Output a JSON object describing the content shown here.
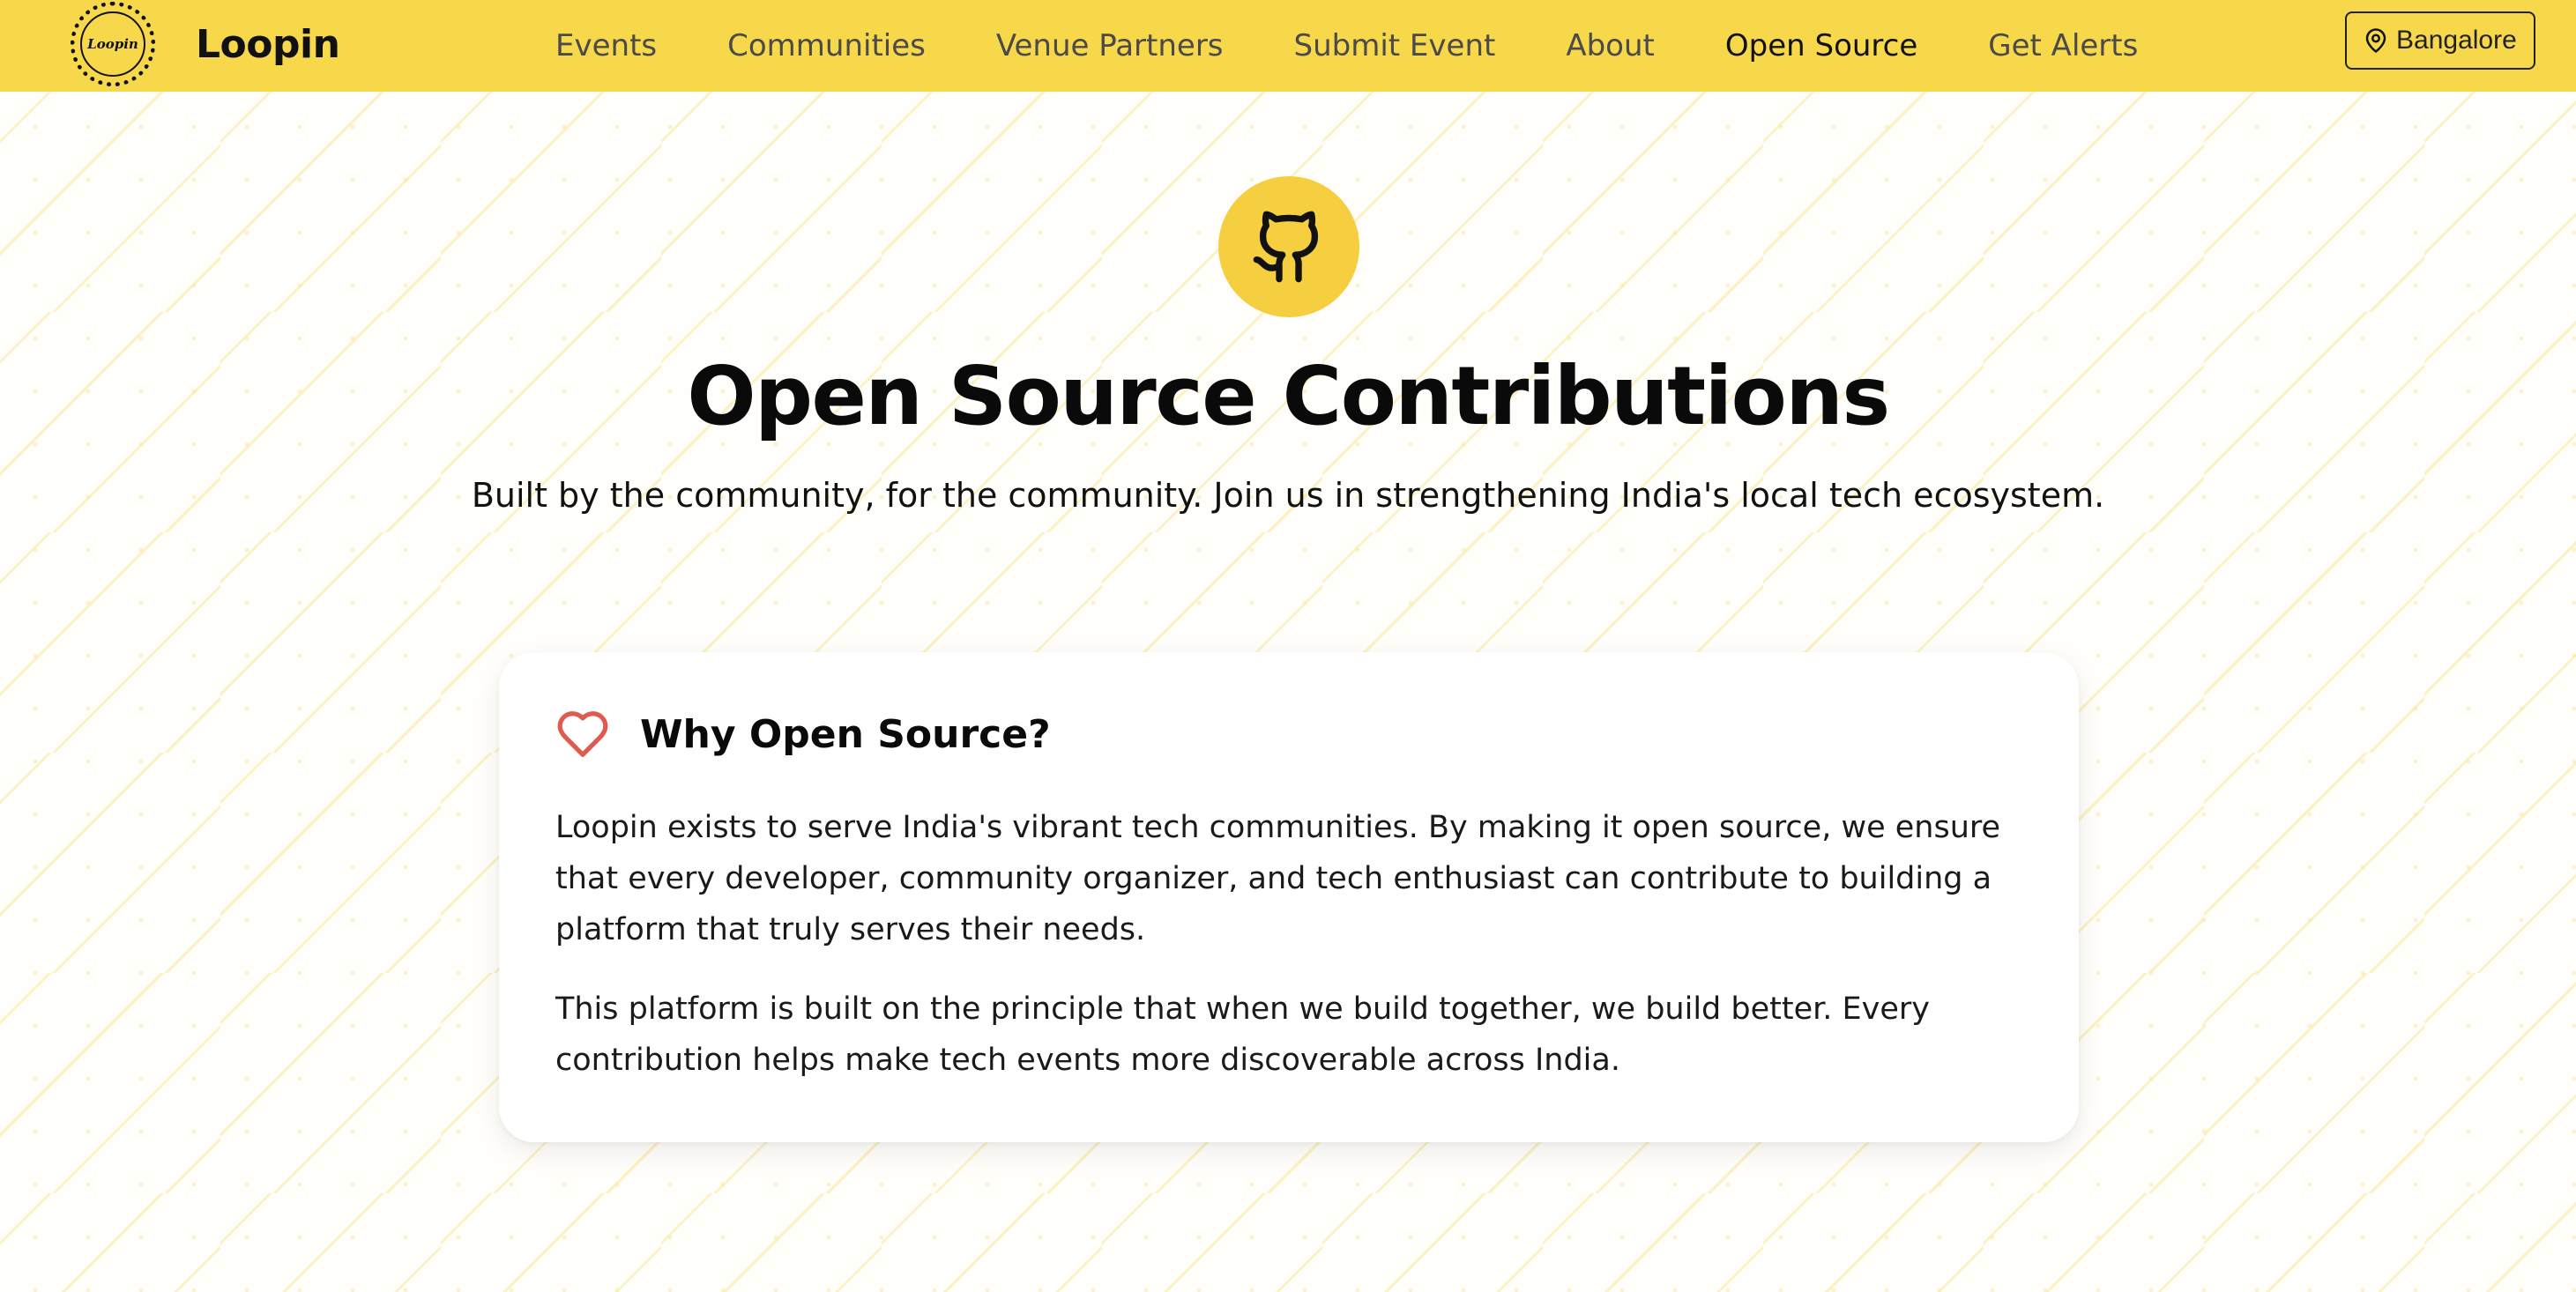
{
  "brand": {
    "badge_text": "Loopin",
    "name": "Loopin"
  },
  "nav": {
    "items": [
      {
        "label": "Events"
      },
      {
        "label": "Communities"
      },
      {
        "label": "Venue Partners"
      },
      {
        "label": "Submit Event"
      },
      {
        "label": "About"
      },
      {
        "label": "Open Source",
        "active": true
      },
      {
        "label": "Get Alerts"
      }
    ]
  },
  "location": {
    "label": "Bangalore",
    "icon": "map-pin-icon"
  },
  "hero": {
    "icon": "github-icon",
    "title": "Open Source Contributions",
    "subtitle": "Built by the community, for the community. Join us in strengthening India's local tech ecosystem."
  },
  "why_card": {
    "icon": "heart-icon",
    "title": "Why Open Source?",
    "paragraphs": [
      "Loopin exists to serve India's vibrant tech communities. By making it open source, we ensure that every developer, community organizer, and tech enthusiast can contribute to building a platform that truly serves their needs.",
      "This platform is built on the principle that when we build together, we build better. Every contribution helps make tech events more discoverable across India."
    ]
  },
  "colors": {
    "header_bg": "#f7d84b",
    "accent": "#f5cf3f",
    "heart": "#e05a4f",
    "text": "#111111"
  }
}
